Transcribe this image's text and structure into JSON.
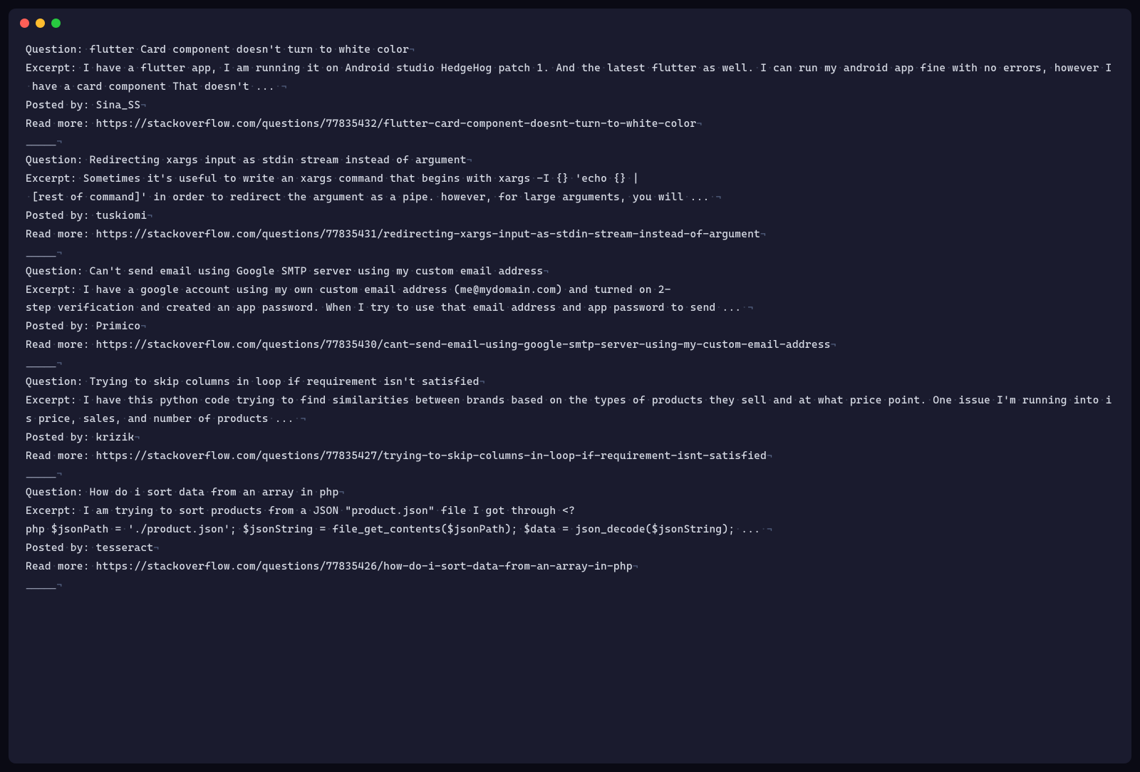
{
  "labels": {
    "question": "Question:",
    "excerpt": "Excerpt:",
    "posted_by": "Posted by:",
    "read_more": "Read more:",
    "separator": "_____"
  },
  "entries": [
    {
      "question": "flutter Card component doesn't turn to white color",
      "excerpt": "I have a flutter app, I am running it on Android studio HedgeHog patch 1. And the latest flutter as well. I can run my android app fine with no errors, however I have a card component That doesn't ... ",
      "posted_by": "Sina_SS",
      "read_more": "https://stackoverflow.com/questions/77835432/flutter-card-component-doesnt-turn-to-white-color",
      "show_separator": true
    },
    {
      "question": "Redirecting xargs input as stdin stream instead of argument",
      "excerpt": "Sometimes it's useful to write an xargs command that begins with xargs -I {} 'echo {} | [rest of command]' in order to redirect the argument as a pipe. however, for large arguments, you will ... ",
      "posted_by": "tuskiomi",
      "read_more": "https://stackoverflow.com/questions/77835431/redirecting-xargs-input-as-stdin-stream-instead-of-argument",
      "show_separator": true
    },
    {
      "question": "Can't send email using Google SMTP server using my custom email address",
      "excerpt": "I have a google account using my own custom email address (me@mydomain.com) and turned on 2-step verification and created an app password. When I try to use that email address and app password to send ... ",
      "posted_by": "Primico",
      "read_more": "https://stackoverflow.com/questions/77835430/cant-send-email-using-google-smtp-server-using-my-custom-email-address",
      "show_separator": true
    },
    {
      "question": "Trying to skip columns in loop if requirement isn't satisfied",
      "excerpt": "I have this python code trying to find similarities between brands based on the types of products they sell and at what price point. One issue I'm running into is price, sales, and number of products ... ",
      "posted_by": "krizik",
      "read_more": "https://stackoverflow.com/questions/77835427/trying-to-skip-columns-in-loop-if-requirement-isnt-satisfied",
      "show_separator": true
    },
    {
      "question": "How do i sort data from an array in php",
      "excerpt": "I am trying to sort products from a JSON \"product.json\" file I got through <?php $jsonPath = './product.json'; $jsonString = file_get_contents($jsonPath); $data = json_decode($jsonString); ... ",
      "posted_by": "tesseract",
      "read_more": "https://stackoverflow.com/questions/77835426/how-do-i-sort-data-from-an-array-in-php",
      "show_separator": true
    }
  ]
}
